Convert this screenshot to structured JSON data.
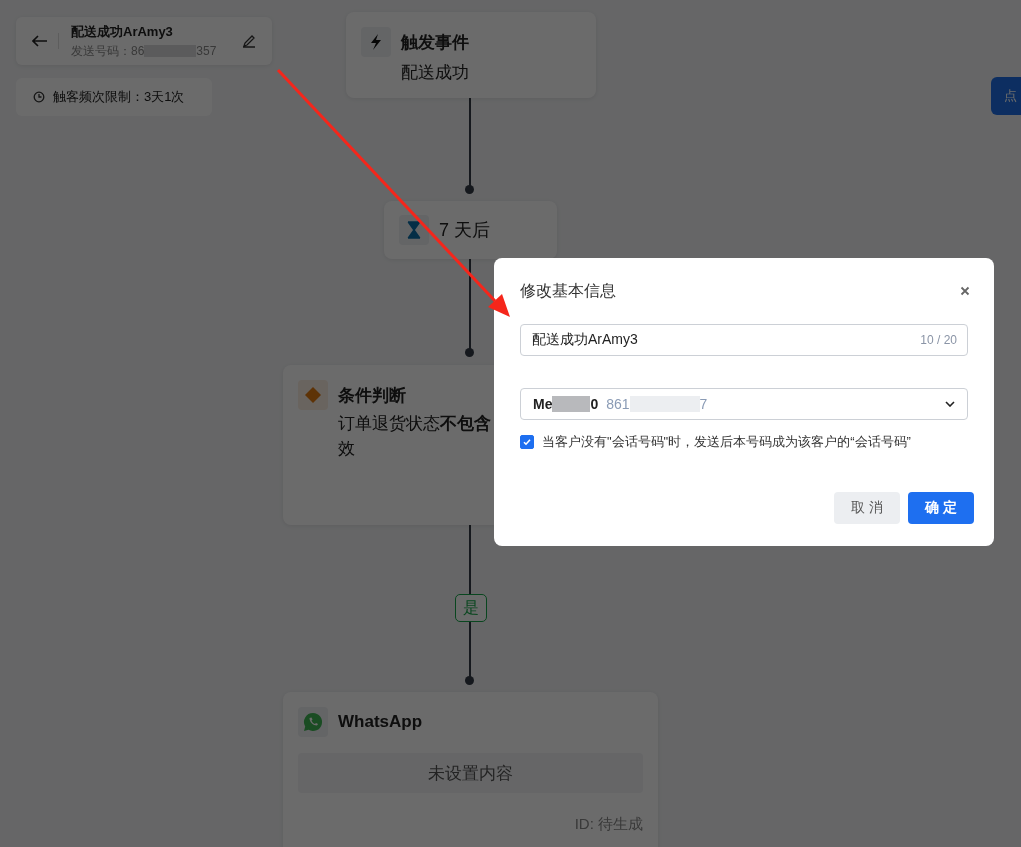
{
  "header": {
    "title": "配送成功ArAmy3",
    "sender_prefix": "发送号码：86",
    "sender_suffix": "357"
  },
  "frequency_limit": "触客频次限制：3天1次",
  "side_button": "点",
  "nodes": [
    {
      "kind": "trigger",
      "title": "触发事件",
      "detail": "配送成功"
    },
    {
      "kind": "delay",
      "title": "7 天后"
    },
    {
      "kind": "condition",
      "title": "条件判断",
      "detail_lines": [
        "订单退货状态**不包含**",
        "效"
      ]
    },
    {
      "kind": "whatsapp",
      "title": "WhatsApp",
      "content": "未设置内容",
      "id_text": "ID: 待生成"
    }
  ],
  "branch_label": "是",
  "dialog": {
    "title": "修改基本信息",
    "name_value": "配送成功ArAmy3",
    "counter": "10 / 20",
    "sender": {
      "name_start": "Me",
      "name_end": "0",
      "number_start": "861",
      "number_end": "7"
    },
    "checkbox": {
      "label": "当客户没有\"会话号码\"时，发送后本号码成为该客户的“会话号码”",
      "checked": true
    },
    "cancel": "取 消",
    "ok": "确 定"
  }
}
